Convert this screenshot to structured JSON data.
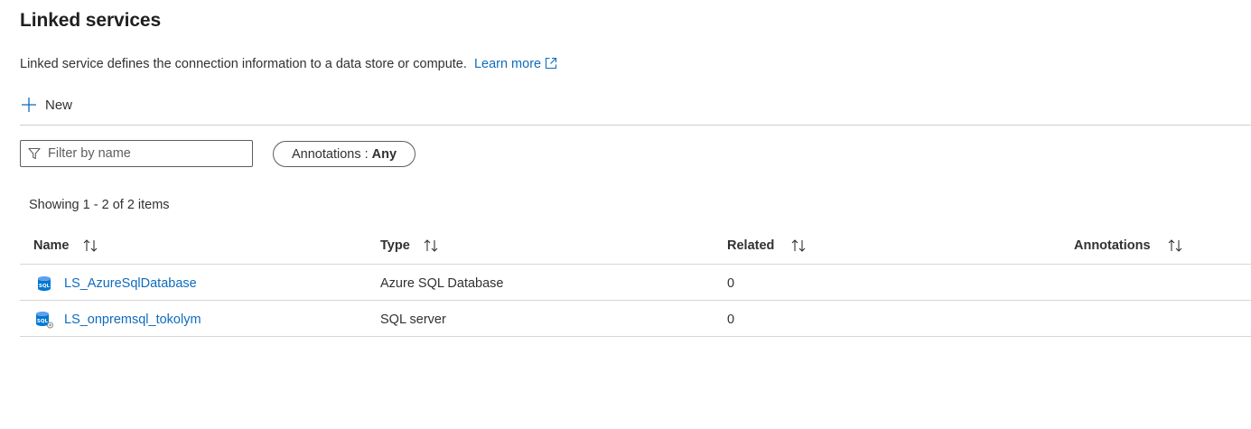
{
  "page": {
    "title": "Linked services"
  },
  "description": {
    "text": "Linked service defines the connection information to a data store or compute.",
    "learn_more": "Learn more"
  },
  "toolbar": {
    "new_label": "New"
  },
  "filter": {
    "placeholder": "Filter by name",
    "value": ""
  },
  "annotations_filter": {
    "label": "Annotations :",
    "value": "Any"
  },
  "count_text": "Showing 1 - 2 of 2 items",
  "table": {
    "columns": [
      {
        "label": "Name"
      },
      {
        "label": "Type"
      },
      {
        "label": "Related"
      },
      {
        "label": "Annotations"
      }
    ],
    "rows": [
      {
        "name": "LS_AzureSqlDatabase",
        "type": "Azure SQL Database",
        "related": "0",
        "annotations": "",
        "icon": "azure-sql-database-icon"
      },
      {
        "name": "LS_onpremsql_tokolym",
        "type": "SQL server",
        "related": "0",
        "annotations": "",
        "icon": "sql-server-icon"
      }
    ],
    "icon_text": "SQL"
  },
  "colors": {
    "link": "#0f6cbd",
    "text": "#323130",
    "border": "#605e5c",
    "divider": "#d2d0ce"
  }
}
